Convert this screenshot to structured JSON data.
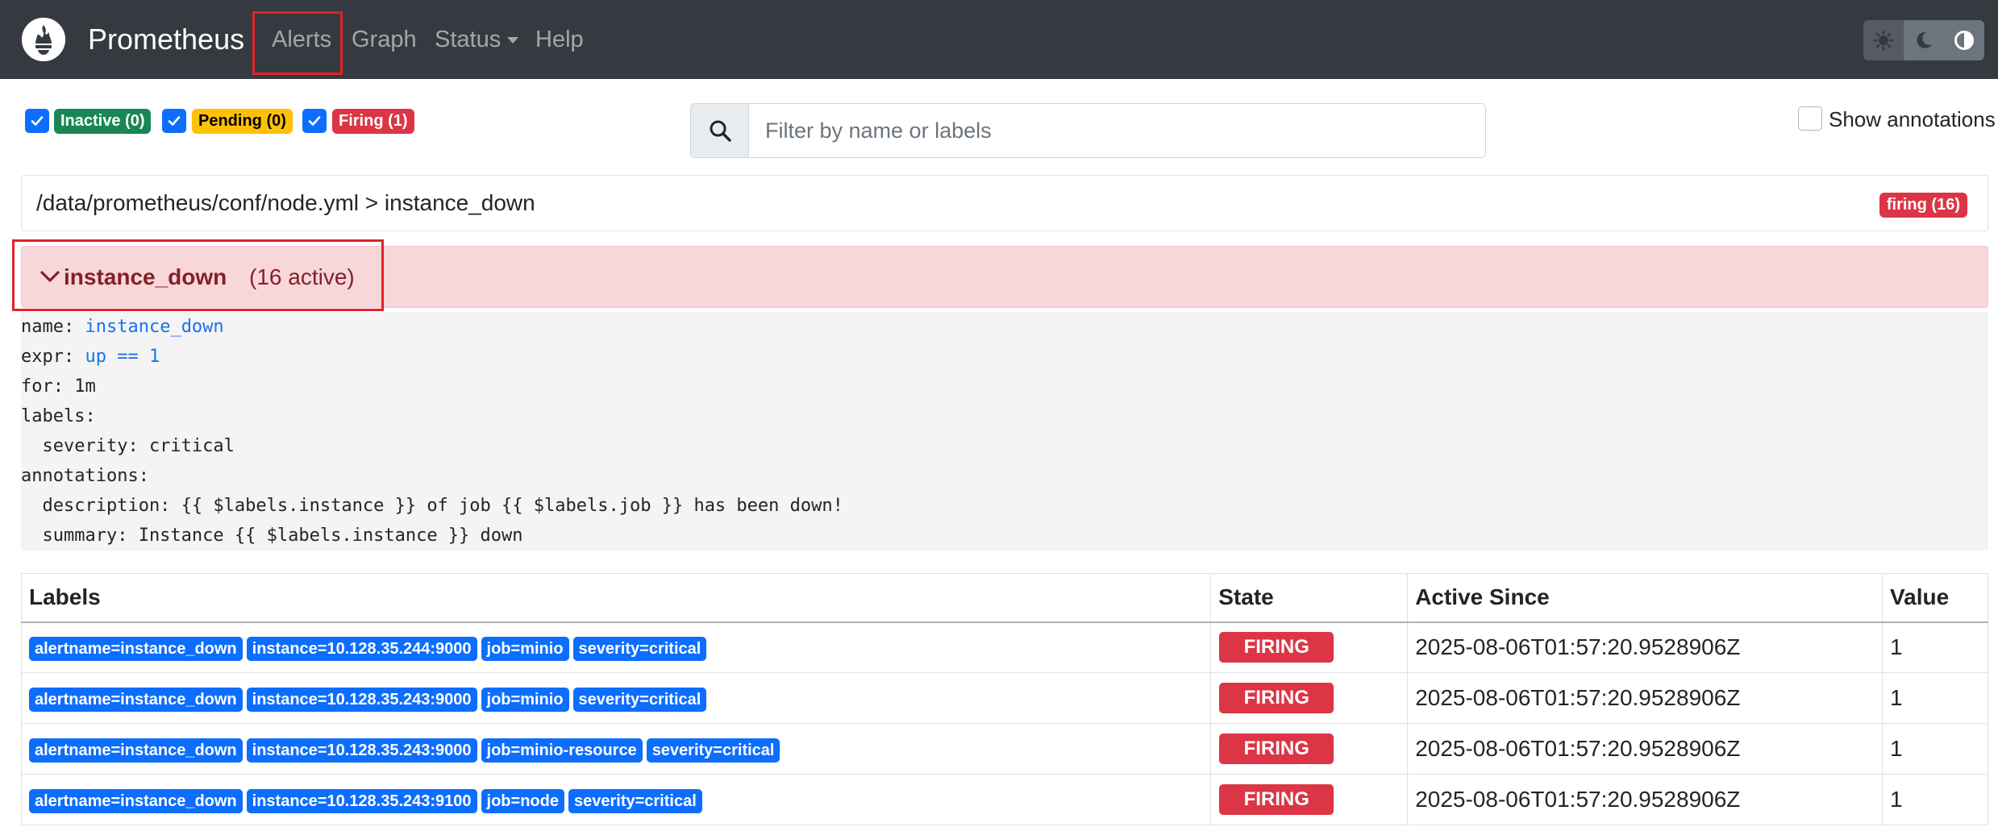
{
  "navbar": {
    "brand": "Prometheus",
    "items": [
      {
        "label": "Alerts"
      },
      {
        "label": "Graph"
      },
      {
        "label": "Status"
      },
      {
        "label": "Help"
      }
    ],
    "theme_buttons": [
      "sun-icon",
      "moon-icon",
      "contrast-icon"
    ]
  },
  "filters": {
    "inactive": "Inactive (0)",
    "pending": "Pending (0)",
    "firing": "Firing (1)",
    "search_placeholder": "Filter by name or labels",
    "show_annotations": "Show annotations"
  },
  "group": {
    "path": "/data/prometheus/conf/node.yml > instance_down",
    "firing_badge": "firing (16)"
  },
  "rule": {
    "name": "instance_down",
    "active": "(16 active)",
    "definition": {
      "name_key": "name: ",
      "name_val": "instance_down",
      "expr_key": "expr: ",
      "expr_val": "up == 1",
      "for_line": "for: 1m",
      "labels_line": "labels:",
      "severity_line": "  severity: critical",
      "annotations_line": "annotations:",
      "description_line": "  description: {{ $labels.instance }} of job {{ $labels.job }} has been down!",
      "summary_line": "  summary: Instance {{ $labels.instance }} down"
    }
  },
  "table": {
    "headers": {
      "labels": "Labels",
      "state": "State",
      "since": "Active Since",
      "value": "Value"
    },
    "rows": [
      {
        "labels": [
          "alertname=instance_down",
          "instance=10.128.35.244:9000",
          "job=minio",
          "severity=critical"
        ],
        "state": "FIRING",
        "since": "2025-08-06T01:57:20.9528906Z",
        "value": "1"
      },
      {
        "labels": [
          "alertname=instance_down",
          "instance=10.128.35.243:9000",
          "job=minio",
          "severity=critical"
        ],
        "state": "FIRING",
        "since": "2025-08-06T01:57:20.9528906Z",
        "value": "1"
      },
      {
        "labels": [
          "alertname=instance_down",
          "instance=10.128.35.243:9000",
          "job=minio-resource",
          "severity=critical"
        ],
        "state": "FIRING",
        "since": "2025-08-06T01:57:20.9528906Z",
        "value": "1"
      },
      {
        "labels": [
          "alertname=instance_down",
          "instance=10.128.35.243:9100",
          "job=node",
          "severity=critical"
        ],
        "state": "FIRING",
        "since": "2025-08-06T01:57:20.9528906Z",
        "value": "1"
      }
    ]
  },
  "colors": {
    "navbar": "#343a40",
    "primary": "#0d6efd",
    "danger": "#dc3545",
    "success": "#198754",
    "warning": "#ffc107",
    "rule_bg": "#f8d7da",
    "highlight": "#e0232a"
  }
}
